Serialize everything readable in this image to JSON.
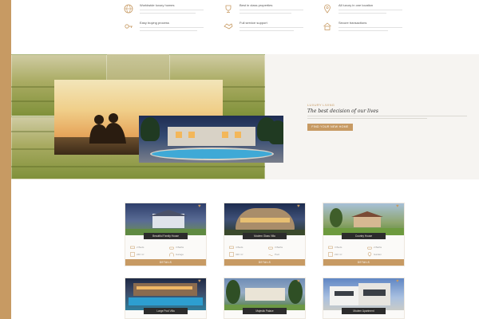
{
  "features": [
    {
      "icon": "globe-icon",
      "title": "Worldwide luxury homes"
    },
    {
      "icon": "trophy-icon",
      "title": "Best in class properties"
    },
    {
      "icon": "map-pin-icon",
      "title": "All luxury in one location"
    },
    {
      "icon": "key-icon",
      "title": "Easy buying process"
    },
    {
      "icon": "handshake-icon",
      "title": "Full service support"
    },
    {
      "icon": "home-icon",
      "title": "Secure transactions"
    }
  ],
  "hero": {
    "kicker": "LUXURY LIVING",
    "headline": "The best decision of our lives",
    "button": "FIND YOUR NEW HOME"
  },
  "listings": [
    {
      "title": "Beautiful Family House",
      "button": "DETAILS",
      "meta": [
        "2 Beds",
        "3 Baths",
        "240 m²",
        "Garage"
      ]
    },
    {
      "title": "Modern Glass Villa",
      "button": "DETAILS",
      "meta": [
        "4 Beds",
        "3 Baths",
        "320 m²",
        "Pool"
      ]
    },
    {
      "title": "Country House",
      "button": "DETAILS",
      "meta": [
        "3 Beds",
        "2 Baths",
        "210 m²",
        "Garden"
      ]
    },
    {
      "title": "Large Pool Villa",
      "button": "DETAILS"
    },
    {
      "title": "Majestic Palace",
      "button": "DETAILS"
    },
    {
      "title": "Modern Apartment",
      "button": "DETAILS"
    }
  ],
  "colors": {
    "accent": "#c79a63",
    "dark": "#2c2c2c",
    "band": "#f6f4f1"
  }
}
